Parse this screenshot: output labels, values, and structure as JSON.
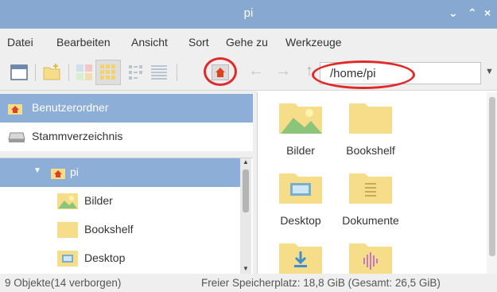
{
  "window": {
    "title": "pi"
  },
  "menu": [
    "Datei",
    "Bearbeiten",
    "Ansicht",
    "Sort",
    "Gehe zu",
    "Werkzeuge"
  ],
  "toolbar": {
    "path_value": "/home/pi"
  },
  "places": [
    {
      "label": "Benutzerordner",
      "icon": "home-icon"
    },
    {
      "label": "Stammverzeichnis",
      "icon": "drive-icon"
    }
  ],
  "tree": [
    {
      "label": "pi",
      "icon": "home-icon"
    },
    {
      "label": "Bilder",
      "icon": "pictures-folder-icon"
    },
    {
      "label": "Bookshelf",
      "icon": "folder-icon"
    },
    {
      "label": "Desktop",
      "icon": "desktop-folder-icon"
    }
  ],
  "files": [
    {
      "label": "Bilder",
      "icon": "pictures-folder-icon"
    },
    {
      "label": "Bookshelf",
      "icon": "folder-icon"
    },
    {
      "label": "Desktop",
      "icon": "desktop-folder-icon"
    },
    {
      "label": "Dokumente",
      "icon": "documents-folder-icon"
    },
    {
      "label": "",
      "icon": "downloads-folder-icon"
    },
    {
      "label": "",
      "icon": "music-folder-icon"
    }
  ],
  "status": {
    "objects": "9 Objekte(14 verborgen)",
    "free_space": "Freier Speicherplatz: 18,8 GiB (Gesamt: 26,5 GiB)"
  },
  "colors": {
    "titlebar": "#87a8d0",
    "selected": "#8daed6",
    "folder": "#f6dd8a",
    "highlight_ring": "#e02a2a"
  }
}
